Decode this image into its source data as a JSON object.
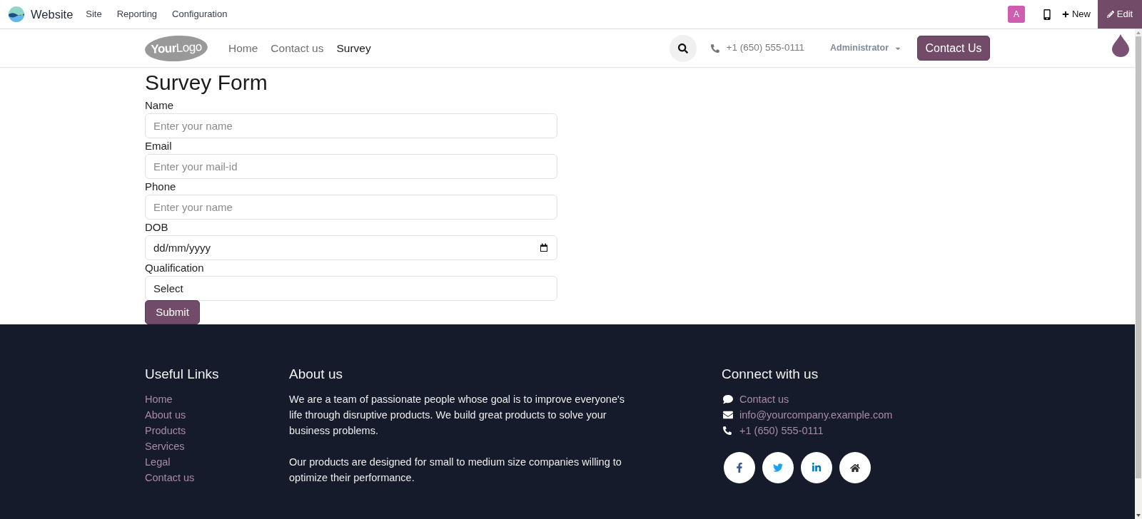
{
  "top_bar": {
    "app_name": "Website",
    "menu": [
      "Site",
      "Reporting",
      "Configuration"
    ],
    "avatar_letter": "A",
    "new_button": "New",
    "edit_button": "Edit"
  },
  "header": {
    "logo": "**Your**Logo",
    "nav": [
      {
        "label": "Home",
        "selected": false
      },
      {
        "label": "Contact us",
        "selected": false
      },
      {
        "label": "Survey",
        "selected": true
      }
    ],
    "phone": "+1 (650) 555-0111",
    "user_menu": "Administrator",
    "contact_button": "Contact Us"
  },
  "form": {
    "title": "Survey Form",
    "fields": [
      {
        "kind": "text",
        "label": "Name",
        "placeholder": "Enter your name"
      },
      {
        "kind": "text",
        "label": "Email",
        "placeholder": "Enter your mail-id"
      },
      {
        "kind": "text",
        "label": "Phone",
        "placeholder": "Enter your name"
      },
      {
        "kind": "date",
        "label": "DOB",
        "placeholder": "dd/mm/yyyy"
      },
      {
        "kind": "select",
        "label": "Qualification",
        "value": "Select"
      }
    ],
    "submit_button": "Submit"
  },
  "footer": {
    "useful_links": {
      "title": "Useful Links",
      "links": [
        "Home",
        "About us",
        "Products",
        "Services",
        "Legal",
        "Contact us"
      ]
    },
    "about": {
      "title": "About us",
      "paragraphs": [
        "We are a team of passionate people whose goal is to improve everyone's life through disruptive products. We build great products to solve your business problems.",
        "Our products are designed for small to medium size companies willing to optimize their performance."
      ]
    },
    "connect": {
      "title": "Connect with us",
      "items": [
        {
          "kind": "chat",
          "text": "Contact us"
        },
        {
          "kind": "email",
          "text": "info@yourcompany.example.com"
        },
        {
          "kind": "phone",
          "text": "+1 (650) 555-0111"
        }
      ]
    }
  }
}
